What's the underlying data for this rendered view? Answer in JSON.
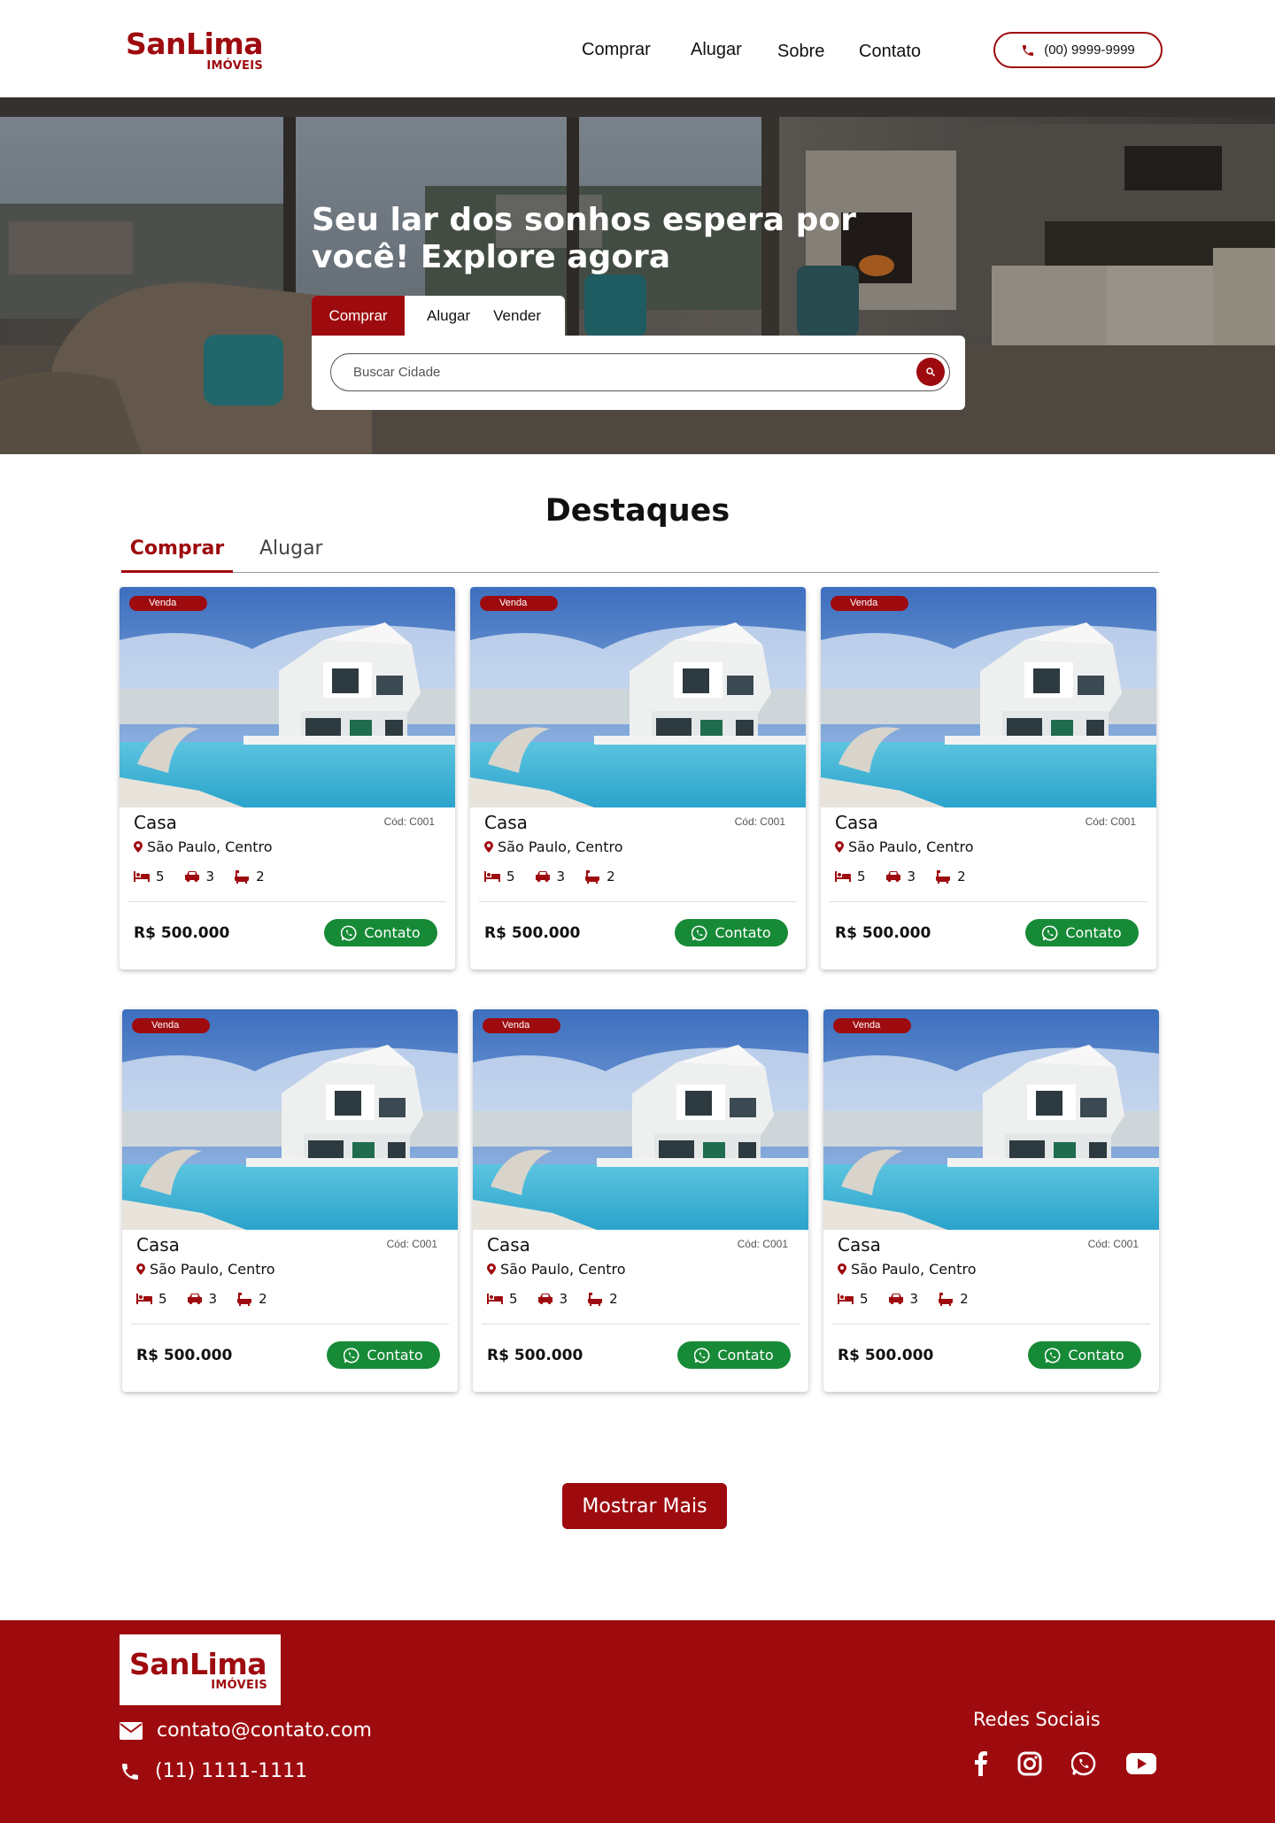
{
  "brand": {
    "name": "SanLima",
    "sub": "IMÓVEIS",
    "color": "#9e0b0f"
  },
  "nav": {
    "items": [
      "Comprar",
      "Alugar",
      "Sobre",
      "Contato"
    ],
    "phone": "(00) 9999-9999"
  },
  "hero": {
    "title": "Seu lar dos sonhos espera por você! Explore agora",
    "tabs": [
      "Comprar",
      "Alugar",
      "Vender"
    ],
    "search_placeholder": "Buscar Cidade"
  },
  "featured": {
    "title": "Destaques",
    "tabs": [
      "Comprar",
      "Alugar"
    ],
    "cards": [
      {
        "badge": "Venda",
        "type": "Casa",
        "code": "Cód: C001",
        "location": "São Paulo, Centro",
        "beds": "5",
        "cars": "3",
        "baths": "2",
        "price": "R$ 500.000",
        "button": "Contato"
      },
      {
        "badge": "Venda",
        "type": "Casa",
        "code": "Cód: C001",
        "location": "São Paulo, Centro",
        "beds": "5",
        "cars": "3",
        "baths": "2",
        "price": "R$ 500.000",
        "button": "Contato"
      },
      {
        "badge": "Venda",
        "type": "Casa",
        "code": "Cód: C001",
        "location": "São Paulo, Centro",
        "beds": "5",
        "cars": "3",
        "baths": "2",
        "price": "R$ 500.000",
        "button": "Contato"
      },
      {
        "badge": "Venda",
        "type": "Casa",
        "code": "Cód: C001",
        "location": "São Paulo, Centro",
        "beds": "5",
        "cars": "3",
        "baths": "2",
        "price": "R$ 500.000",
        "button": "Contato"
      },
      {
        "badge": "Venda",
        "type": "Casa",
        "code": "Cód: C001",
        "location": "São Paulo, Centro",
        "beds": "5",
        "cars": "3",
        "baths": "2",
        "price": "R$ 500.000",
        "button": "Contato"
      },
      {
        "badge": "Venda",
        "type": "Casa",
        "code": "Cód: C001",
        "location": "São Paulo, Centro",
        "beds": "5",
        "cars": "3",
        "baths": "2",
        "price": "R$ 500.000",
        "button": "Contato"
      }
    ],
    "more_button": "Mostrar Mais"
  },
  "footer": {
    "email": "contato@contato.com",
    "phone": "(11) 1111-1111",
    "social_title": "Redes Sociais",
    "social_icons": [
      "facebook-icon",
      "instagram-icon",
      "whatsapp-icon",
      "youtube-icon"
    ]
  },
  "colors": {
    "primary": "#9e0b0f",
    "whatsapp": "#178a37"
  }
}
